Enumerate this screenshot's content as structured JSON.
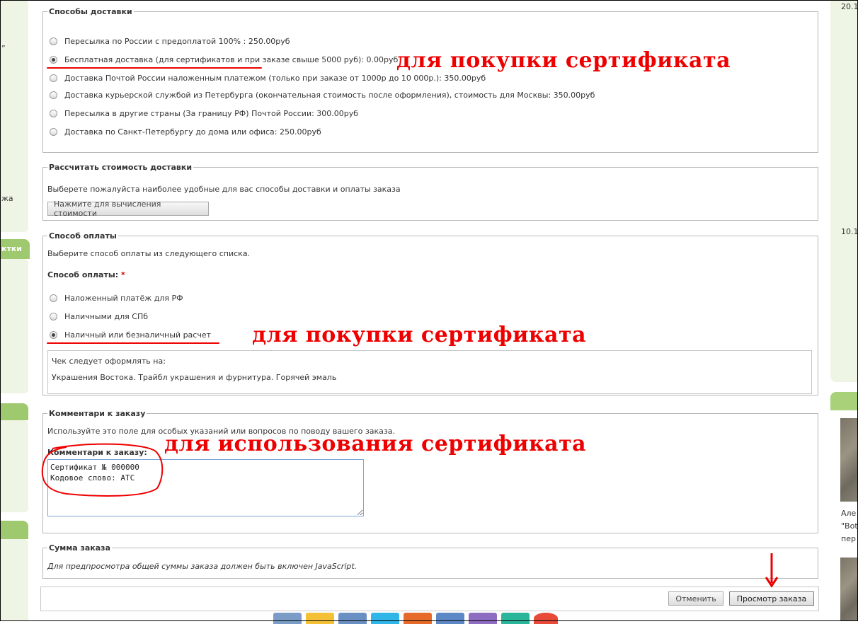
{
  "sidebar_left": {
    "fragments": [
      "”",
      "жа",
      "ктки"
    ]
  },
  "sidebar_right": {
    "dates": [
      "20.1",
      "10.1"
    ],
    "snippets": [
      "Але",
      "\"Bot",
      "пер"
    ]
  },
  "delivery": {
    "legend": "Способы доставки",
    "options": [
      {
        "label": "Пересылка по России с предоплатой 100% : 250.00руб",
        "checked": false
      },
      {
        "label": "Бесплатная доставка (для сертификатов и при заказе свыше 5000 руб): 0.00руб",
        "checked": true
      },
      {
        "label": "Доставка Почтой России наложенным платежом (только при заказе от 1000р до 10 000р.): 350.00руб",
        "checked": false
      },
      {
        "label": "Доставка курьерской службой из Петербурга (окончательная стоимость после оформления), стоимость для Москвы: 350.00руб",
        "checked": false
      },
      {
        "label": "Пересылка в другие страны (За границу РФ) Почтой России: 300.00руб",
        "checked": false
      },
      {
        "label": "Доставка по Санкт-Петербургу до дома или офиса: 250.00руб",
        "checked": false
      }
    ],
    "annotation": "для покупки сертификата"
  },
  "calc": {
    "legend": "Рассчитать стоимость доставки",
    "description": "Выберете пожалуйста наиболее удобные для вас способы доставки и оплаты заказа",
    "button": "Нажмите для вычисления стоимости"
  },
  "payment": {
    "legend": "Способ оплаты",
    "description": "Выберите способ оплаты из следующего списка.",
    "field_label": "Способ оплаты:",
    "required_mark": "*",
    "options": [
      {
        "label": "Наложенный платёж для РФ",
        "checked": false
      },
      {
        "label": "Наличными для СПб",
        "checked": false
      },
      {
        "label": "Наличный или безналичный расчет",
        "checked": true
      }
    ],
    "annotation": "для покупки сертификата",
    "info_title": "Чек следует оформлять на:",
    "info_text": "Украшения Востока. Трайбл украшения и фурнитура. Горячей эмаль"
  },
  "comments": {
    "legend": "Комментари к заказу",
    "description": "Используйте это поле для особых указаний или вопросов по поводу вашего заказа.",
    "field_label": "Комментари к заказу:",
    "value": "Сертификат № 000000\nКодовое слово: АТС",
    "annotation": "для использования сертификата"
  },
  "summary": {
    "legend": "Сумма заказа",
    "note": "Для предпросмотра общей суммы заказа должен быть включен JavaScript."
  },
  "actions": {
    "cancel": "Отменить",
    "preview": "Просмотр заказа"
  },
  "colors": {
    "annotation_red": "#ee0000",
    "sidebar_green": "#9fc96f",
    "sidebar_panel": "#eef5e4"
  },
  "social_colors": [
    "#7a9cc6",
    "#f4c136",
    "#6a8fc2",
    "#2fb5e8",
    "#e66b2b",
    "#5d88c6",
    "#8e6cc2",
    "#2bb59b",
    "#e84a3a"
  ]
}
